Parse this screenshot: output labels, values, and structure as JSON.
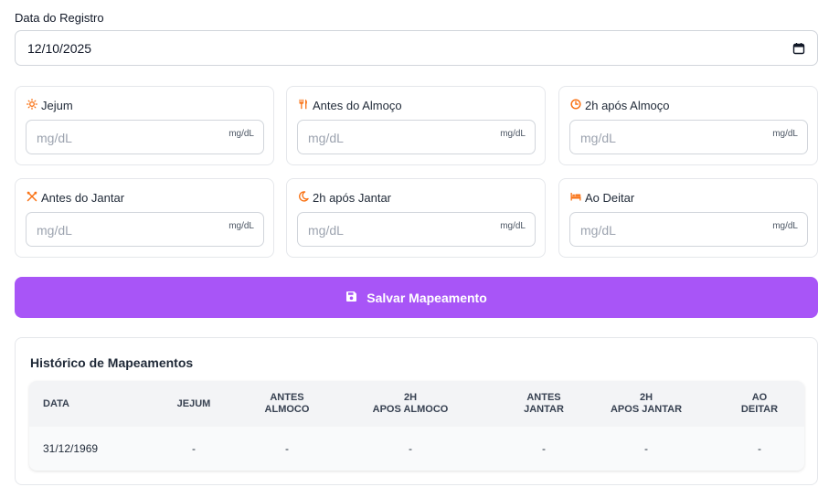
{
  "date": {
    "label": "Data do Registro",
    "value": "12/10/2025"
  },
  "fields": [
    {
      "label": "Jejum",
      "placeholder": "mg/dL",
      "unit": "mg/dL"
    },
    {
      "label": "Antes do Almoço",
      "placeholder": "mg/dL",
      "unit": "mg/dL"
    },
    {
      "label": "2h após Almoço",
      "placeholder": "mg/dL",
      "unit": "mg/dL"
    },
    {
      "label": "Antes do Jantar",
      "placeholder": "mg/dL",
      "unit": "mg/dL"
    },
    {
      "label": "2h após Jantar",
      "placeholder": "mg/dL",
      "unit": "mg/dL"
    },
    {
      "label": "Ao Deitar",
      "placeholder": "mg/dL",
      "unit": "mg/dL"
    }
  ],
  "colors": {
    "accent": "#a855f7",
    "icon": "#f97316"
  },
  "icons": [
    "sun-icon",
    "utensils-icon",
    "clock-icon",
    "utensils-crossed-icon",
    "moon-icon",
    "bed-icon"
  ],
  "save_button": {
    "label": "Salvar Mapeamento"
  },
  "history": {
    "title": "Histórico de Mapeamentos",
    "columns": [
      [
        "DATA"
      ],
      [
        "JEJUM"
      ],
      [
        "ANTES",
        "ALMOCO"
      ],
      [
        "2H",
        "APOS ALMOCO"
      ],
      [
        "ANTES",
        "JANTAR"
      ],
      [
        "2H",
        "APOS JANTAR"
      ],
      [
        "AO",
        "DEITAR"
      ]
    ],
    "rows": [
      [
        "31/12/1969",
        "-",
        "-",
        "-",
        "-",
        "-",
        "-"
      ]
    ]
  }
}
